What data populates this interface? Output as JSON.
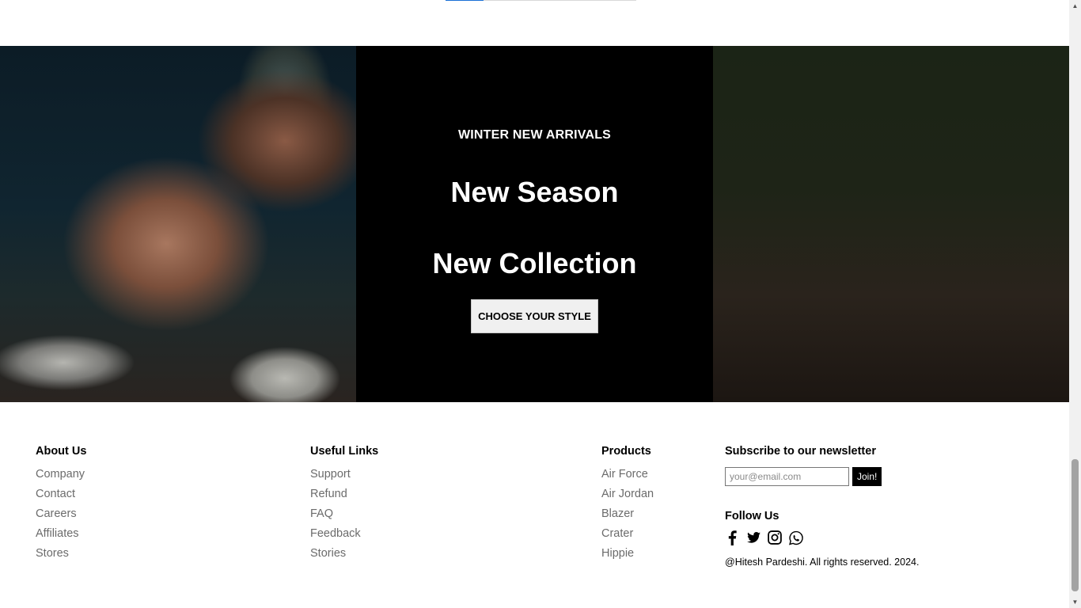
{
  "progress": {
    "fraction": 0.2
  },
  "banner": {
    "kicker": "WINTER NEW ARRIVALS",
    "headline_line1": "New Season",
    "headline_line2": "New Collection",
    "cta_label": "CHOOSE YOUR STYLE"
  },
  "footer": {
    "about": {
      "heading": "About Us",
      "links": [
        "Company",
        "Contact",
        "Careers",
        "Affiliates",
        "Stores"
      ]
    },
    "useful": {
      "heading": "Useful Links",
      "links": [
        "Support",
        "Refund",
        "FAQ",
        "Feedback",
        "Stories"
      ]
    },
    "products": {
      "heading": "Products",
      "links": [
        "Air Force",
        "Air Jordan",
        "Blazer",
        "Crater",
        "Hippie"
      ]
    },
    "newsletter": {
      "heading": "Subscribe to our newsletter",
      "email_placeholder": "your@email.com",
      "join_label": "Join!",
      "follow_heading": "Follow Us",
      "socials": [
        "facebook-icon",
        "twitter-icon",
        "instagram-icon",
        "whatsapp-icon"
      ],
      "copyright": "@Hitesh Pardeshi. All rights reserved. 2024."
    }
  },
  "scrollbar": {
    "position": 0.85
  }
}
